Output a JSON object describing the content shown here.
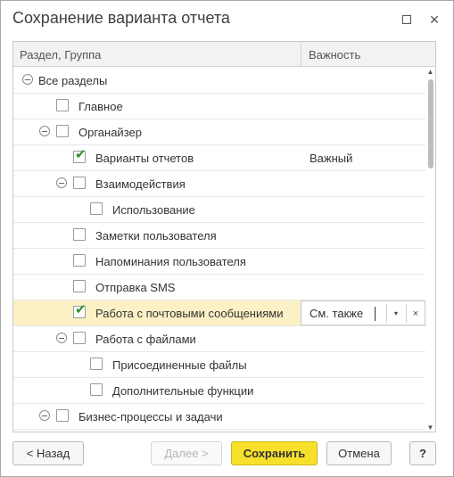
{
  "window": {
    "title": "Сохранение варианта отчета",
    "close_glyph": "✕"
  },
  "grid": {
    "columns": [
      "Раздел, Группа",
      "Важность"
    ],
    "rows": [
      {
        "label": "Все разделы",
        "importance": ""
      },
      {
        "label": "Главное",
        "importance": "",
        "checked": false
      },
      {
        "label": "Органайзер",
        "importance": "",
        "checked": false
      },
      {
        "label": "Варианты отчетов",
        "importance": "Важный",
        "checked": true
      },
      {
        "label": "Взаимодействия",
        "importance": "",
        "checked": false
      },
      {
        "label": "Использование",
        "importance": "",
        "checked": false
      },
      {
        "label": "Заметки пользователя",
        "importance": "",
        "checked": false
      },
      {
        "label": "Напоминания пользователя",
        "importance": "",
        "checked": false
      },
      {
        "label": "Отправка SMS",
        "importance": "",
        "checked": false
      },
      {
        "label": "Работа с почтовыми сообщениями",
        "importance": "См. также",
        "checked": true,
        "selected": true
      },
      {
        "label": "Работа с файлами",
        "importance": "",
        "checked": false
      },
      {
        "label": "Присоединенные файлы",
        "importance": "",
        "checked": false
      },
      {
        "label": "Дополнительные функции",
        "importance": "",
        "checked": false
      },
      {
        "label": "Бизнес-процессы и задачи",
        "importance": "",
        "checked": false
      }
    ],
    "edit_icons": {
      "dropdown": "▾",
      "clear": "×"
    },
    "check_glyph": "✔",
    "scroll_up_glyph": "▲",
    "scroll_down_glyph": "▼"
  },
  "buttons": {
    "back": "< Назад",
    "next": "Далее >",
    "save": "Сохранить",
    "cancel": "Отмена",
    "help": "?"
  },
  "colors": {
    "save_button": "#f7e02a",
    "selected_row": "#fbf1c5",
    "checkmark": "#2f8f2f"
  }
}
